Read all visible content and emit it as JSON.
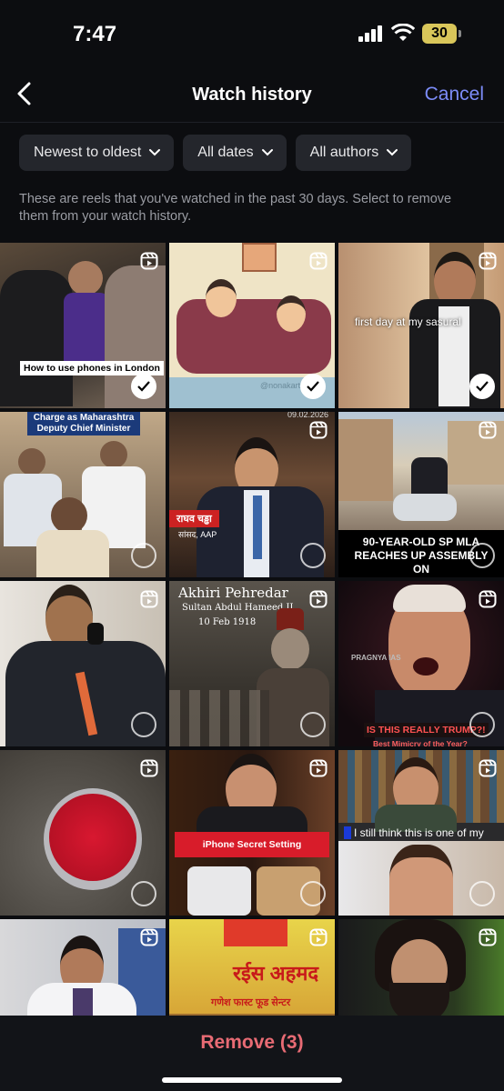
{
  "status": {
    "time": "7:47",
    "battery": "30"
  },
  "nav": {
    "title": "Watch history",
    "cancel": "Cancel"
  },
  "filters": [
    "Newest to oldest",
    "All dates",
    "All authors"
  ],
  "description": "These are reels that you've watched in the past 30 days. Select to remove them from your watch history.",
  "tiles": [
    {
      "caption": "How to use phones in London",
      "selected": true
    },
    {
      "caption": "",
      "selected": true,
      "overlay": "@nonakart"
    },
    {
      "caption": "first day at my sasural",
      "selected": true
    },
    {
      "caption": "Charge as Maharashtra Deputy Chief Minister",
      "selected": false
    },
    {
      "caption": "राघव चड्ढा",
      "caption2": "सांसद, AAP",
      "selected": false,
      "date": "09.02.2026"
    },
    {
      "caption": "90-YEAR-OLD SP MLA REACHES UP ASSEMBLY ON",
      "selected": false
    },
    {
      "caption": "",
      "selected": false
    },
    {
      "caption": "Akhiri Pehredar",
      "caption2": "Sultan Abdul Hameed II",
      "caption3": "10 Feb 1918",
      "selected": false
    },
    {
      "caption": "IS THIS REALLY TRUMP?!",
      "caption2": "Best Mimicry of the Year?",
      "watermark": "PRAGNYA IAS",
      "selected": false
    },
    {
      "caption": "",
      "selected": false
    },
    {
      "caption": "iPhone Secret Setting",
      "selected": false
    },
    {
      "caption": "I still think this is one of my",
      "selected": false
    },
    {
      "caption": "",
      "selected": false
    },
    {
      "caption": "रईस अहमद",
      "caption2": "गणेश फास्ट फूड सेन्टर",
      "selected": false
    },
    {
      "caption": "",
      "selected": false
    }
  ],
  "bottom": {
    "remove_label": "Remove (3)"
  },
  "colors": {
    "accent": "#7c8cf8",
    "remove": "#e86b74",
    "background": "#0c0d10",
    "chip": "#24262c"
  }
}
